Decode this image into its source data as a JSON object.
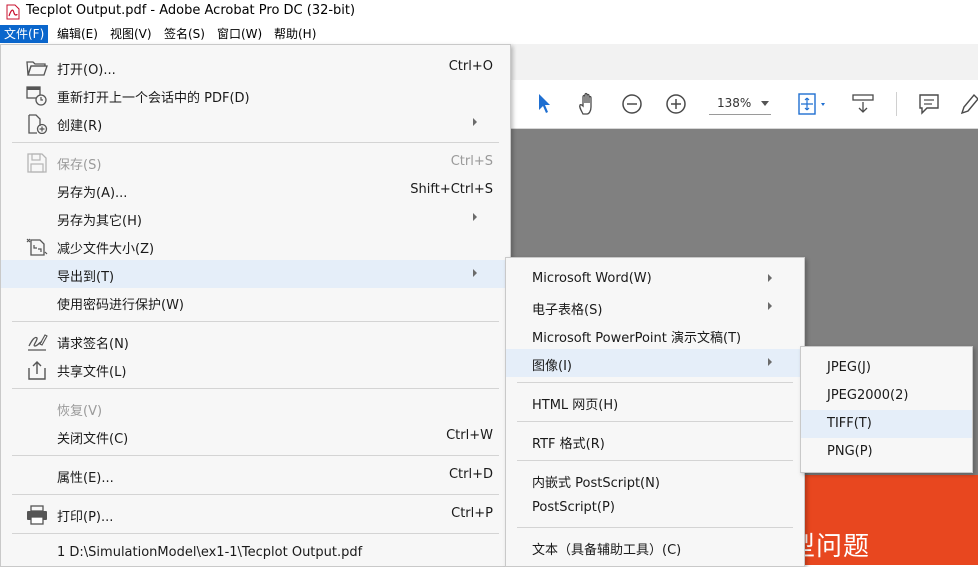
{
  "window": {
    "title": "Tecplot Output.pdf - Adobe Acrobat Pro DC (32-bit)"
  },
  "menubar": [
    {
      "label": "文件(F)"
    },
    {
      "label": "编辑(E)"
    },
    {
      "label": "视图(V)"
    },
    {
      "label": "签名(S)"
    },
    {
      "label": "窗口(W)"
    },
    {
      "label": "帮助(H)"
    }
  ],
  "toolbar": {
    "zoom": "138%"
  },
  "file_menu": [
    {
      "label": "打开(O)...",
      "shortcut": "Ctrl+O"
    },
    {
      "label": "重新打开上一个会话中的 PDF(D)",
      "shortcut": ""
    },
    {
      "label": "创建(R)",
      "shortcut": ""
    },
    {
      "label": "保存(S)",
      "shortcut": "Ctrl+S"
    },
    {
      "label": "另存为(A)...",
      "shortcut": "Shift+Ctrl+S"
    },
    {
      "label": "另存为其它(H)",
      "shortcut": ""
    },
    {
      "label": "减少文件大小(Z)",
      "shortcut": ""
    },
    {
      "label": "导出到(T)",
      "shortcut": ""
    },
    {
      "label": "使用密码进行保护(W)",
      "shortcut": ""
    },
    {
      "label": "请求签名(N)",
      "shortcut": ""
    },
    {
      "label": "共享文件(L)",
      "shortcut": ""
    },
    {
      "label": "恢复(V)",
      "shortcut": ""
    },
    {
      "label": "关闭文件(C)",
      "shortcut": "Ctrl+W"
    },
    {
      "label": "属性(E)...",
      "shortcut": "Ctrl+D"
    },
    {
      "label": "打印(P)...",
      "shortcut": "Ctrl+P"
    },
    {
      "label": "1 D:\\SimulationModel\\ex1-1\\Tecplot Output.pdf",
      "shortcut": ""
    }
  ],
  "export_menu": [
    {
      "label": "Microsoft Word(W)"
    },
    {
      "label": "电子表格(S)"
    },
    {
      "label": "Microsoft PowerPoint 演示文稿(T)"
    },
    {
      "label": "图像(I)"
    },
    {
      "label": "HTML 网页(H)"
    },
    {
      "label": "RTF 格式(R)"
    },
    {
      "label": "内嵌式 PostScript(N)"
    },
    {
      "label": "PostScript(P)"
    },
    {
      "label": "文本（具备辅助工具）(C)"
    }
  ],
  "image_menu": [
    {
      "label": "JPEG(J)"
    },
    {
      "label": "JPEG2000(2)"
    },
    {
      "label": "TIFF(T)"
    },
    {
      "label": "PNG(P)"
    }
  ],
  "watermark": "非典型问题"
}
